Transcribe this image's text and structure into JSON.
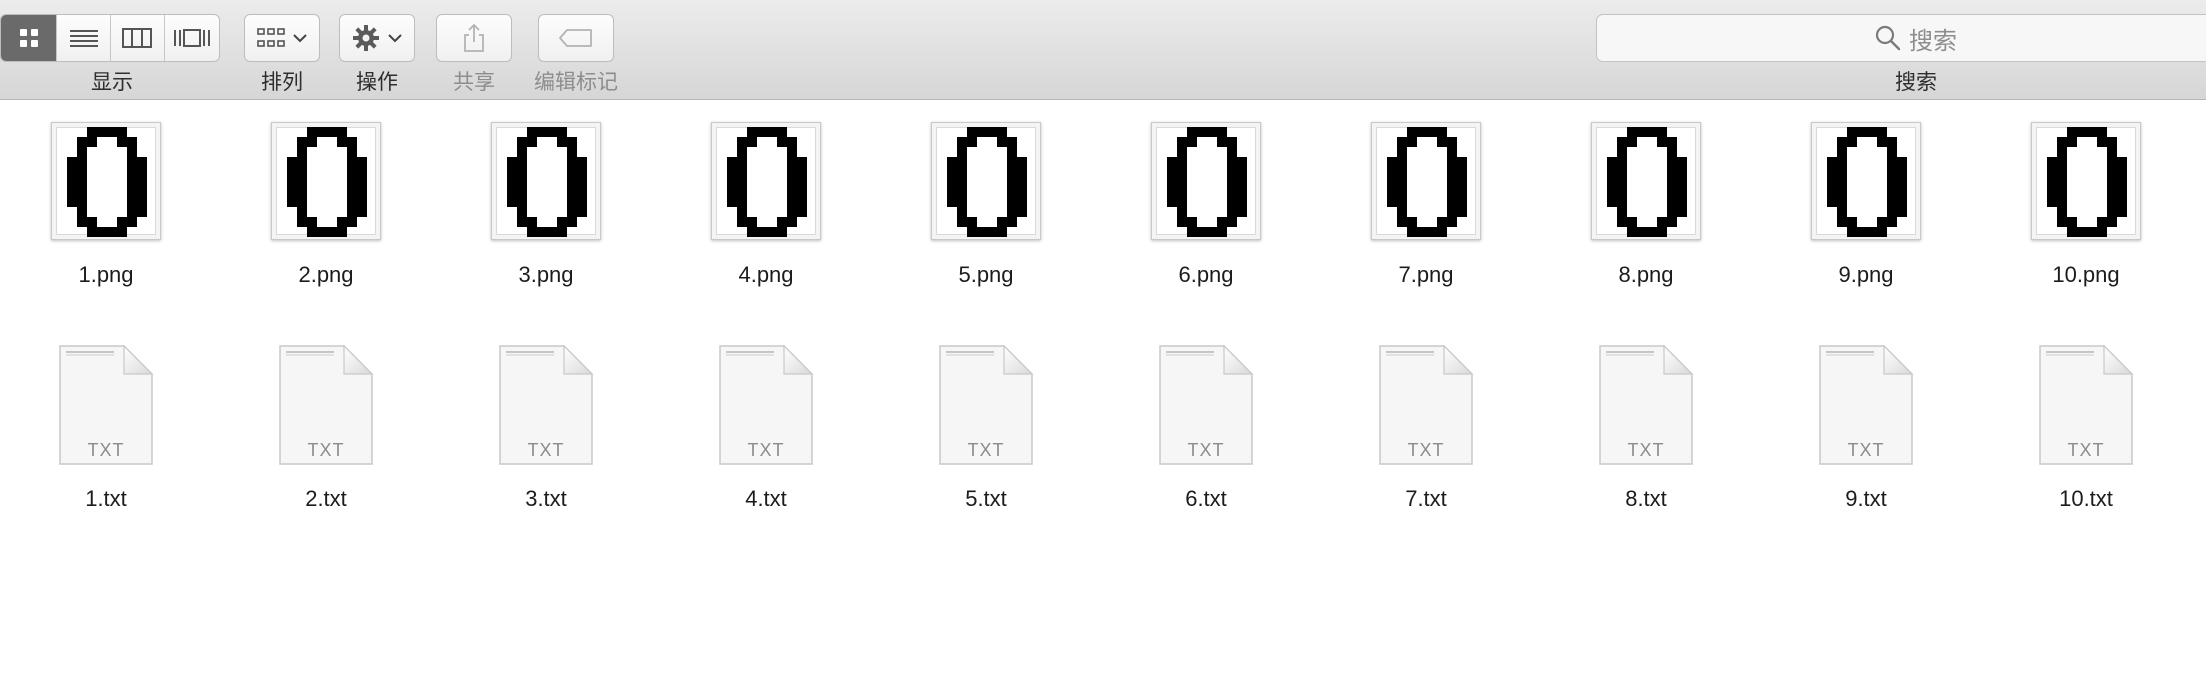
{
  "toolbar": {
    "display_label": "显示",
    "arrange_label": "排列",
    "action_label": "操作",
    "share_label": "共享",
    "tags_label": "编辑标记",
    "search_label": "搜索"
  },
  "search": {
    "placeholder": "搜索"
  },
  "icons": {
    "view_icons": "grid-icon",
    "view_list": "list-icon",
    "view_columns": "columns-icon",
    "view_coverflow": "coverflow-icon",
    "arrange": "grid-arrange-icon",
    "action": "gear-icon",
    "share": "share-icon",
    "tags": "tag-icon",
    "search": "magnifier-icon"
  },
  "files": {
    "png": [
      "1.png",
      "2.png",
      "3.png",
      "4.png",
      "5.png",
      "6.png",
      "7.png",
      "8.png",
      "9.png",
      "10.png"
    ],
    "txt": [
      "1.txt",
      "2.txt",
      "3.txt",
      "4.txt",
      "5.txt",
      "6.txt",
      "7.txt",
      "8.txt",
      "9.txt",
      "10.txt"
    ],
    "txt_badge": "TXT"
  }
}
